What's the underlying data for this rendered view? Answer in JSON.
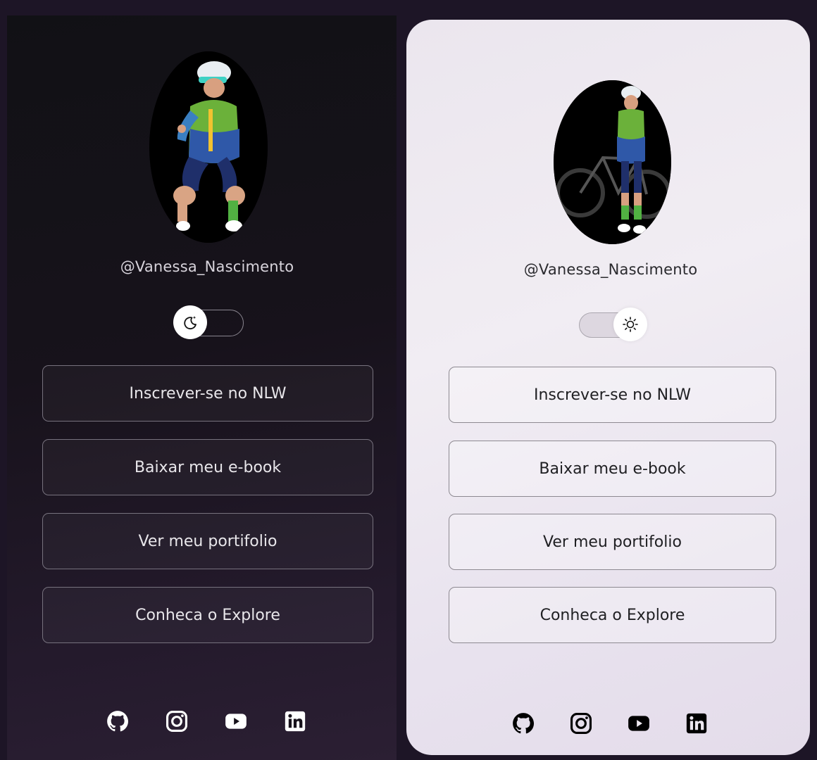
{
  "themes": [
    {
      "name": "dark",
      "handle": "@Vanessa_Nascimento",
      "toggle_icon": "moon-icon",
      "buttons": [
        "Inscrever-se no NLW",
        "Baixar meu e-book",
        "Ver meu portifolio",
        "Conheca o Explore"
      ],
      "social_icons": [
        "github-icon",
        "instagram-icon",
        "youtube-icon",
        "linkedin-icon"
      ],
      "icon_color": "#ffffff"
    },
    {
      "name": "light",
      "handle": "@Vanessa_Nascimento",
      "toggle_icon": "sun-icon",
      "buttons": [
        "Inscrever-se no NLW",
        "Baixar meu e-book",
        "Ver meu portifolio",
        "Conheca o Explore"
      ],
      "social_icons": [
        "github-icon",
        "instagram-icon",
        "youtube-icon",
        "linkedin-icon"
      ],
      "icon_color": "#000000"
    }
  ],
  "colors": {
    "dark_background": "#16121b",
    "light_background": "#ece7ef",
    "dark_border": "#77727e",
    "light_border": "#8d8991"
  }
}
